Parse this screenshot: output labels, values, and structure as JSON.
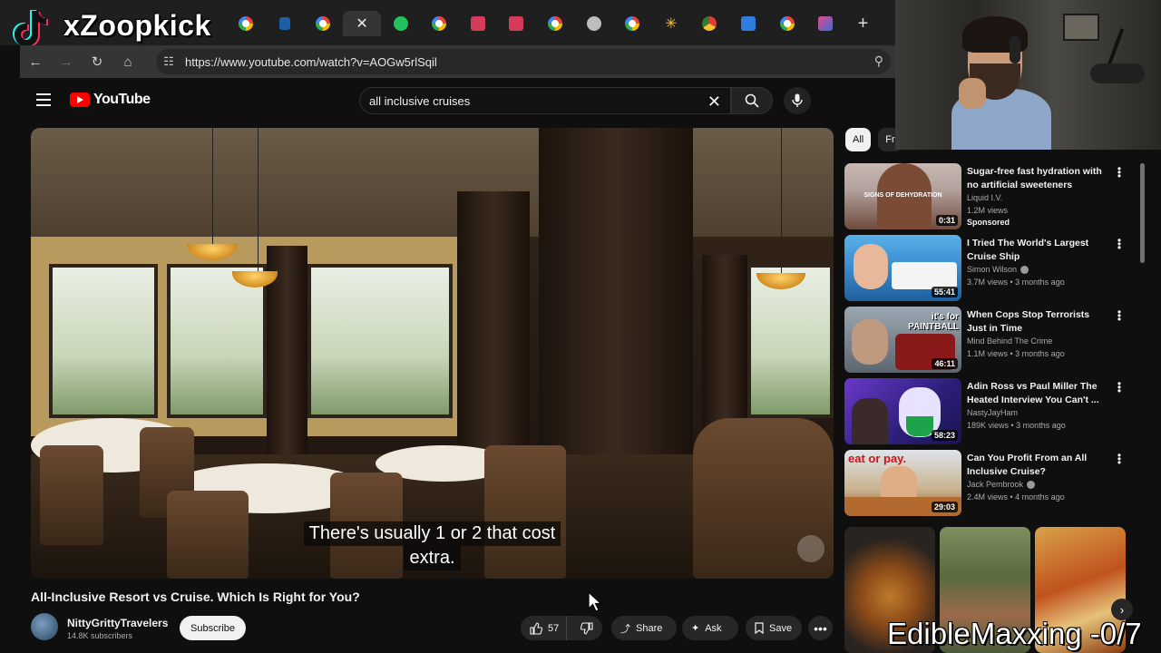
{
  "overlay": {
    "brand_name": "xZoopkick",
    "bottom_text": "EdibleMaxxing -0/7"
  },
  "browser": {
    "url": "https://www.youtube.com/watch?v=AOGw5rlSqil",
    "tabs": [
      {
        "icon": "google-icon"
      },
      {
        "icon": "d-icon"
      },
      {
        "icon": "google-icon"
      },
      {
        "icon": "close-icon",
        "active": true
      },
      {
        "icon": "play-icon"
      },
      {
        "icon": "google-icon"
      },
      {
        "icon": "video-icon"
      },
      {
        "icon": "video-icon"
      },
      {
        "icon": "google-icon"
      },
      {
        "icon": "openai-icon"
      },
      {
        "icon": "google-icon"
      },
      {
        "icon": "walmart-icon"
      },
      {
        "icon": "chrome-icon"
      },
      {
        "icon": "folder-icon"
      },
      {
        "icon": "google-icon"
      },
      {
        "icon": "app-icon"
      }
    ],
    "new_tab_label": "+"
  },
  "youtube": {
    "logo_text": "YouTube",
    "search_value": "all inclusive cruises",
    "caption_line1": "There's usually 1 or 2 that cost",
    "caption_line2": "extra.",
    "video_title": "All-Inclusive Resort vs Cruise. Which Is Right for You?",
    "channel_name": "NittyGrittyTravelers",
    "channel_subs": "14.8K subscribers",
    "subscribe_label": "Subscribe",
    "like_count": "57",
    "share_label": "Share",
    "ask_label": "Ask",
    "save_label": "Save"
  },
  "chips": [
    {
      "label": "All",
      "active": true
    },
    {
      "label": "Fr",
      "active": false
    }
  ],
  "recommendations": [
    {
      "title": "Sugar-free fast hydration with no artificial sweeteners",
      "channel": "Liquid I.V.",
      "meta": "1.2M views",
      "badge": "Sponsored",
      "duration": "0:31",
      "verified": false
    },
    {
      "title": "I Tried The World's Largest Cruise Ship",
      "channel": "Simon Wilson",
      "meta": "3.7M views • 3 months ago",
      "badge": "",
      "duration": "55:41",
      "verified": true
    },
    {
      "title": "When Cops Stop Terrorists Just in Time",
      "channel": "Mind Behind The Crime",
      "meta": "1.1M views • 3 months ago",
      "badge": "",
      "duration": "46:11",
      "verified": false
    },
    {
      "title": "Adin Ross vs Paul Miller The Heated Interview You Can't ...",
      "channel": "NastyJayHam",
      "meta": "189K views • 3 months ago",
      "badge": "",
      "duration": "58:23",
      "verified": false
    },
    {
      "title": "Can You Profit From an All Inclusive Cruise?",
      "channel": "Jack Pembrook",
      "meta": "2.4M views • 4 months ago",
      "badge": "",
      "duration": "29:03",
      "verified": true
    }
  ],
  "thumb_texts": {
    "t1": "SIGNS OF DEHYDRATION",
    "t3": "it's for PAINTBALL",
    "t5": "eat or pay."
  }
}
